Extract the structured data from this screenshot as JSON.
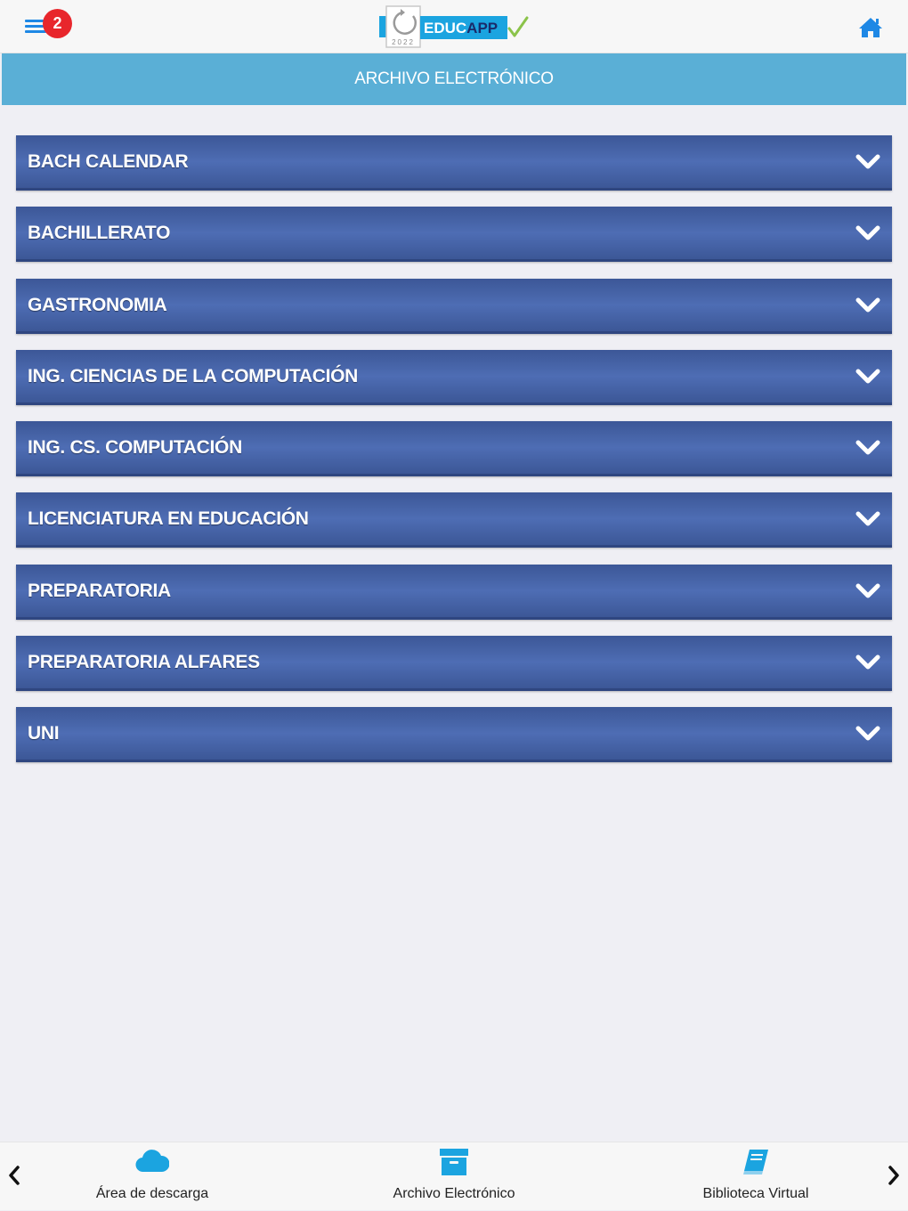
{
  "header": {
    "notification_count": "2",
    "logo": {
      "brand_prefix": "EDUC",
      "brand_suffix": "APP",
      "year": "2022"
    },
    "title": "ARCHIVO ELECTRÓNICO"
  },
  "folders": [
    {
      "label": "BACH CALENDAR"
    },
    {
      "label": "BACHILLERATO"
    },
    {
      "label": "GASTRONOMIA"
    },
    {
      "label": "ING. CIENCIAS DE LA COMPUTACIÓN"
    },
    {
      "label": "ING. CS. COMPUTACIÓN"
    },
    {
      "label": "LICENCIATURA EN EDUCACIÓN"
    },
    {
      "label": "PREPARATORIA"
    },
    {
      "label": "PREPARATORIA ALFARES"
    },
    {
      "label": "UNI"
    }
  ],
  "bottom_nav": {
    "tabs": [
      {
        "label": "Área de descarga",
        "icon": "cloud-icon"
      },
      {
        "label": "Archivo Electrónico",
        "icon": "archive-box-icon"
      },
      {
        "label": "Biblioteca Virtual",
        "icon": "book-icon"
      }
    ]
  },
  "colors": {
    "accent": "#1e88e5",
    "title_bar": "#5aafd6",
    "folder_bar": "#4a67ac",
    "badge": "#e8262c",
    "nav_icon": "#1ba4e0"
  }
}
